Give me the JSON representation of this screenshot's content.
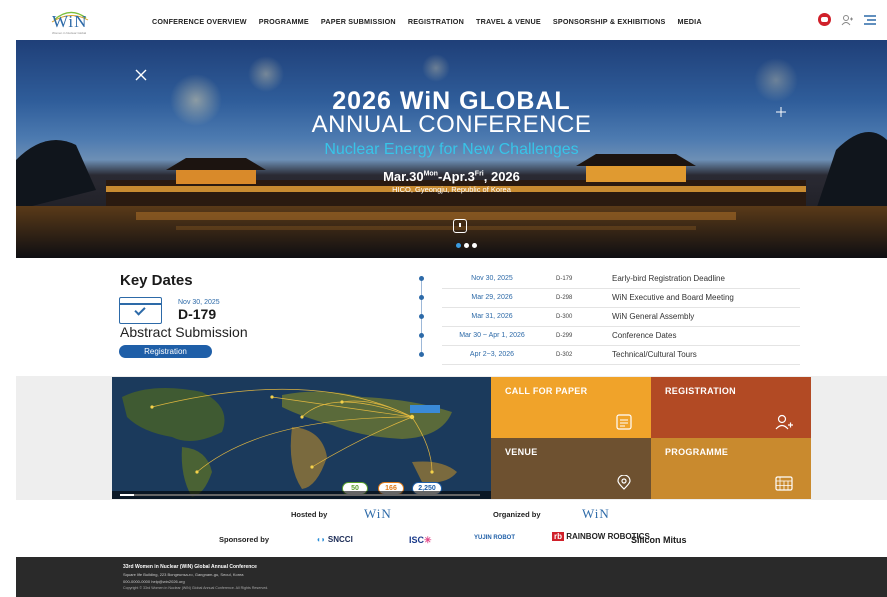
{
  "header": {
    "logo_text": "WiN",
    "logo_tagline": "Women in Nuclear Global",
    "nav": [
      "CONFERENCE OVERVIEW",
      "PROGRAMME",
      "PAPER SUBMISSION",
      "REGISTRATION",
      "TRAVEL & VENUE",
      "SPONSORSHIP & EXHIBITIONS",
      "MEDIA"
    ]
  },
  "hero": {
    "title_line1": "2026 WiN GLOBAL",
    "title_line2": "ANNUAL CONFERENCE",
    "theme": "Nuclear Energy for New Challenges",
    "date_start": "Mar.30",
    "date_start_sup": "Mon",
    "date_sep": "-Apr.3",
    "date_end_sup": "Fri",
    "date_year": ", 2026",
    "venue": "HICO, Gyeongju, Republic of Korea"
  },
  "key_dates": {
    "title": "Key Dates",
    "highlight_date": "Nov 30, 2025",
    "highlight_dday": "D-179",
    "highlight_event": "Abstract Submission",
    "button_label": "Registration",
    "items": [
      {
        "date": "Nov 30, 2025",
        "dday": "D-179",
        "event": "Early-bird Registration Deadline"
      },
      {
        "date": "Mar 29, 2026",
        "dday": "D-298",
        "event": "WiN Executive and Board Meeting"
      },
      {
        "date": "Mar 31, 2026",
        "dday": "D-300",
        "event": "WiN General Assembly"
      },
      {
        "date": "Mar 30 ~ Apr 1, 2026",
        "dday": "D-299",
        "event": "Conference Dates"
      },
      {
        "date": "Apr 2~3, 2026",
        "dday": "D-302",
        "event": "Technical/Cultural Tours"
      }
    ]
  },
  "video": {
    "badges": [
      "50",
      "166",
      "2,250"
    ],
    "colors": {
      "badge1": "#5aa02c",
      "badge2": "#e07b1a",
      "badge3": "#1f5fa8"
    }
  },
  "tiles": {
    "call_for_paper": "CALL FOR PAPER",
    "registration": "REGISTRATION",
    "venue": "VENUE",
    "programme": "PROGRAMME",
    "colors": {
      "call_for_paper": "#f0a32a",
      "registration": "#b24a24",
      "venue": "#6e5130",
      "programme": "#c98a2e"
    }
  },
  "sponsors": {
    "hosted_by": "Hosted by",
    "organized_by": "Organized by",
    "sponsored_by": "Sponsored by",
    "host_logo": "WiN",
    "org_logo": "WiN",
    "sponsor_names": [
      "SNCCI",
      "ISC",
      "YUJIN ROBOT",
      "RAINBOW ROBOTICS",
      "Silicon Mitus"
    ]
  },
  "footer": {
    "line1": "33rd Women in Nuclear (WiN) Global Annual Conference",
    "line2": "Square life Building, 223 Bongeunsa-ro, Gangnam-gu, Seoul, Korea",
    "line3": "000-0000-0000   help@win2026.org",
    "line4": "Copyright © 33rd Women in Nuclear (WiN) Global Annual Conference. All Rights Reserved."
  }
}
